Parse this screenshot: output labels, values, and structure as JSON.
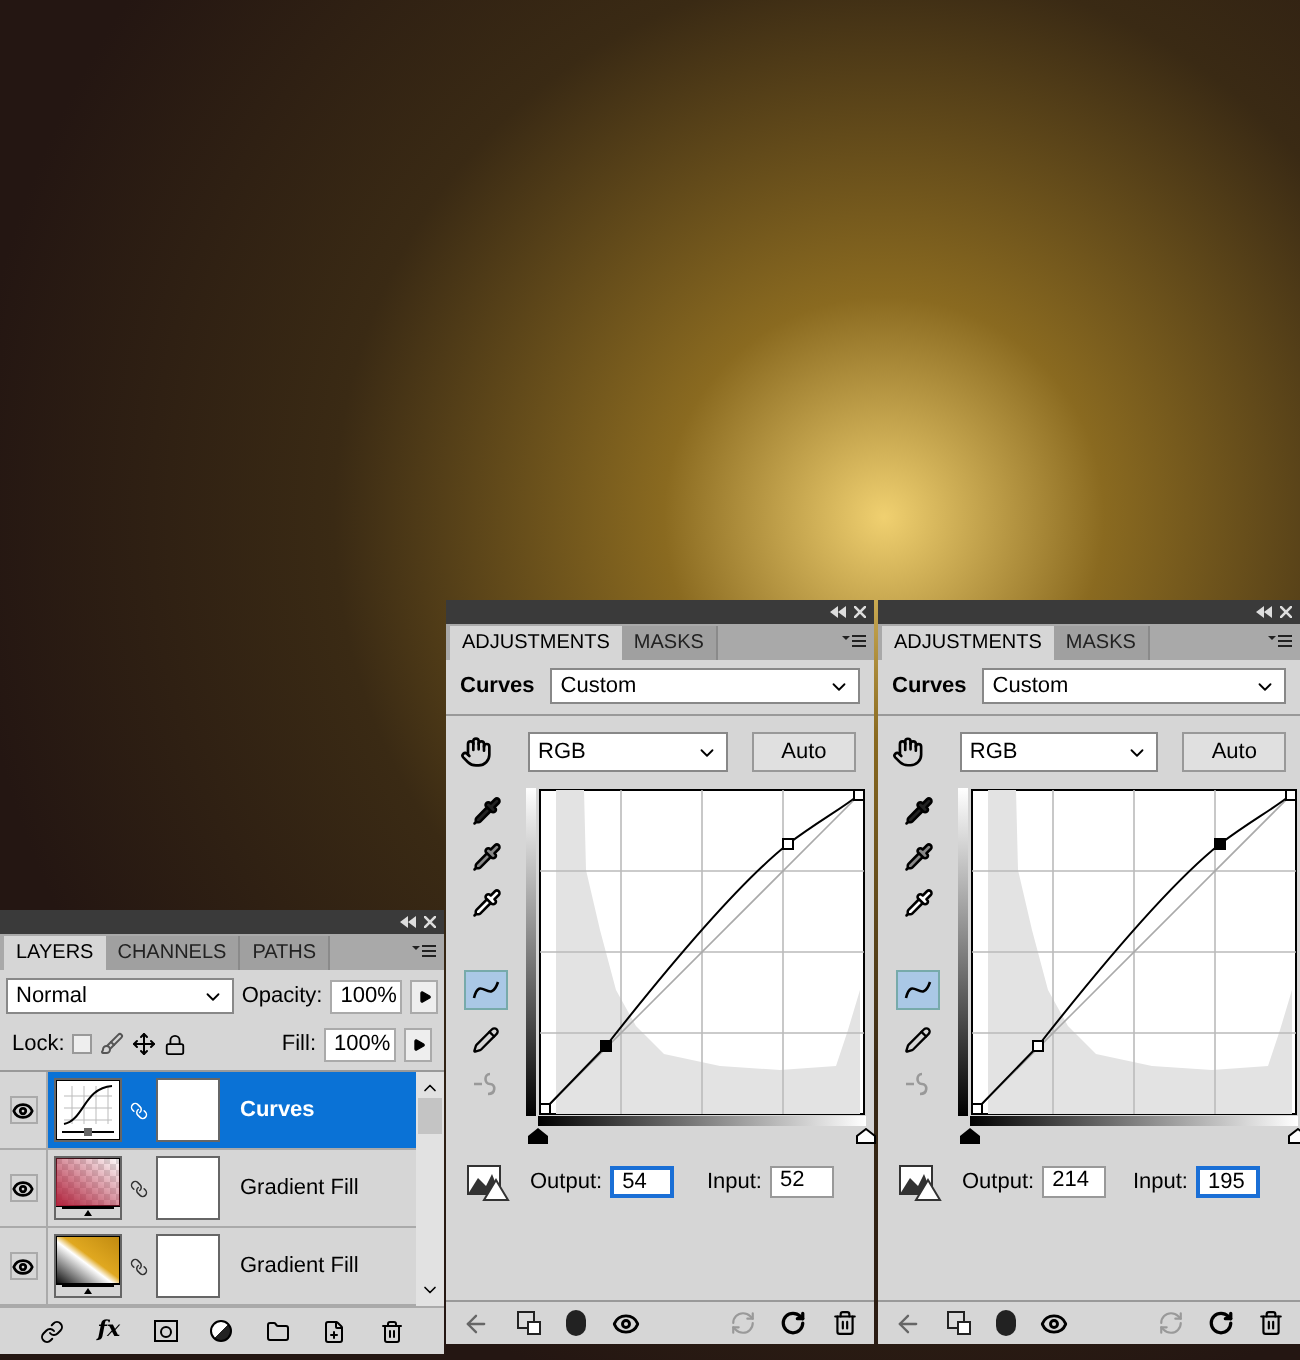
{
  "layers_panel": {
    "tabs": [
      {
        "label": "LAYERS",
        "selected": true
      },
      {
        "label": "CHANNELS",
        "selected": false
      },
      {
        "label": "PATHS",
        "selected": false
      }
    ],
    "blend_mode": "Normal",
    "opacity_label": "Opacity:",
    "opacity": "100%",
    "lock_label": "Lock:",
    "fill_label": "Fill:",
    "fill": "100%",
    "layers": [
      {
        "name": "Curves",
        "kind": "curves",
        "selected": true,
        "visible": true
      },
      {
        "name": "Gradient Fill",
        "kind": "gradient-red",
        "selected": false,
        "visible": true
      },
      {
        "name": "Gradient Fill",
        "kind": "gradient-gold",
        "selected": false,
        "visible": true
      }
    ],
    "fx_button": "fx"
  },
  "adjustment_panels": [
    {
      "tabs": [
        {
          "label": "ADJUSTMENTS",
          "selected": true
        },
        {
          "label": "MASKS",
          "selected": false
        }
      ],
      "title": "Curves",
      "preset": "Custom",
      "channel": "RGB",
      "auto_button": "Auto",
      "curve_points": [
        {
          "selected": true
        },
        {
          "selected": false
        }
      ],
      "shadow_slider": {
        "level": 0
      },
      "highlight_slider": {
        "level": 1
      },
      "output_label": "Output:",
      "output": "54",
      "output_focused": true,
      "input_label": "Input:",
      "input": "52",
      "input_focused": false
    },
    {
      "tabs": [
        {
          "label": "ADJUSTMENTS",
          "selected": true
        },
        {
          "label": "MASKS",
          "selected": false
        }
      ],
      "title": "Curves",
      "preset": "Custom",
      "channel": "RGB",
      "auto_button": "Auto",
      "curve_points": [
        {
          "selected": false
        },
        {
          "selected": true
        }
      ],
      "shadow_slider": {
        "level": 0
      },
      "highlight_slider": {
        "level": 1
      },
      "output_label": "Output:",
      "output": "214",
      "output_focused": false,
      "input_label": "Input:",
      "input": "195",
      "input_focused": true
    }
  ]
}
